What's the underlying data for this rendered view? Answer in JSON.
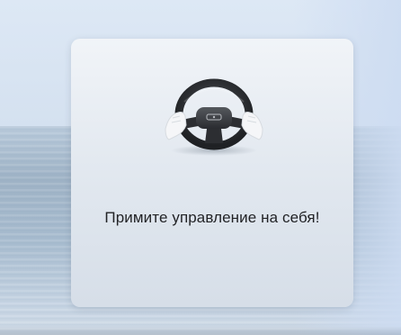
{
  "alert": {
    "icon": "steering-wheel-hands-icon",
    "message": "Примите управление на себя!"
  },
  "colors": {
    "card_top": "#f1f4f8",
    "card_bottom": "#d6dee8",
    "text": "#222326",
    "wheel": "#2e3033"
  }
}
